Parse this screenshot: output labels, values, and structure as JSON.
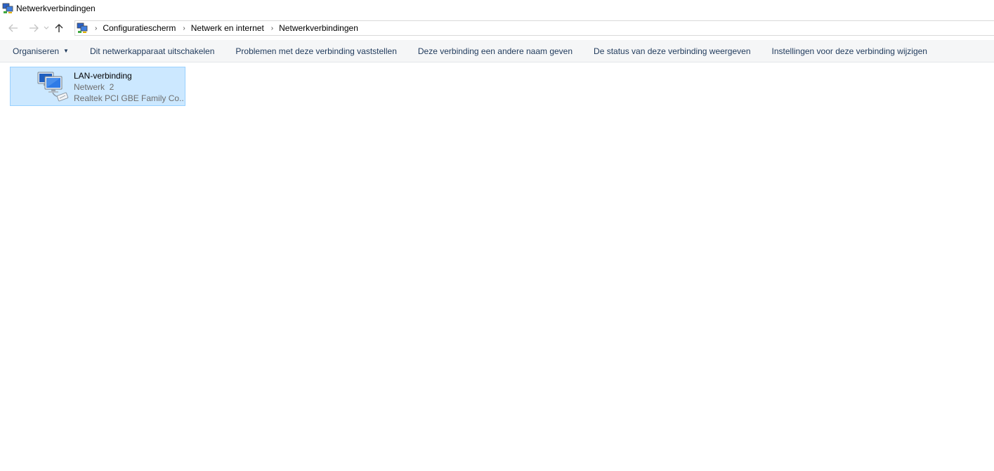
{
  "window": {
    "title": "Netwerkverbindingen",
    "icon": "network-connections-icon"
  },
  "navigation": {
    "back_icon": "back-arrow-icon",
    "forward_icon": "forward-arrow-icon",
    "recent_icon": "chevron-down-icon",
    "up_icon": "up-arrow-icon",
    "breadcrumb": [
      "Configuratiescherm",
      "Netwerk en internet",
      "Netwerkverbindingen"
    ]
  },
  "toolbar": {
    "organize_label": "Organiseren",
    "disable_label": "Dit netwerkapparaat uitschakelen",
    "diagnose_label": "Problemen met deze verbinding vaststellen",
    "rename_label": "Deze verbinding een andere naam geven",
    "status_label": "De status van deze verbinding weergeven",
    "settings_label": "Instellingen voor deze verbinding wijzigen",
    "background_color": "#f5f6f7"
  },
  "connections": [
    {
      "name": "LAN-verbinding",
      "network": "Netwerk  2",
      "adapter": "Realtek PCI GBE Family Co...",
      "selected": true,
      "icon": "ethernet-connection-icon",
      "selection_color": "#cce8ff"
    }
  ]
}
